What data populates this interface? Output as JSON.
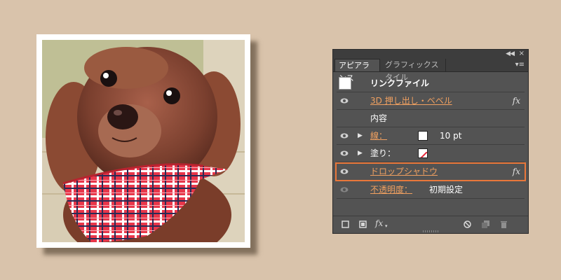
{
  "panel": {
    "tabs": [
      {
        "label": "アピアランス",
        "active": true
      },
      {
        "label": "グラフィックスタイル",
        "active": false
      }
    ],
    "header": {
      "label": "リンクファイル"
    },
    "rows": {
      "bevel": {
        "label": "3D 押し出し・ベベル",
        "fx": "fx"
      },
      "contents": {
        "label": "内容"
      },
      "stroke": {
        "label": "線：",
        "value": "10 pt"
      },
      "fill": {
        "label": "塗り："
      },
      "dropshadow": {
        "label": "ドロップシャドウ",
        "fx": "fx"
      },
      "opacity": {
        "label": "不透明度：",
        "value": "初期設定"
      }
    },
    "bottom": {
      "fx_label": "fx"
    }
  },
  "colors": {
    "background": "#d9c3ab",
    "panel": "#535353",
    "accent_link": "#f0a060",
    "highlight_border": "#e9773a"
  }
}
